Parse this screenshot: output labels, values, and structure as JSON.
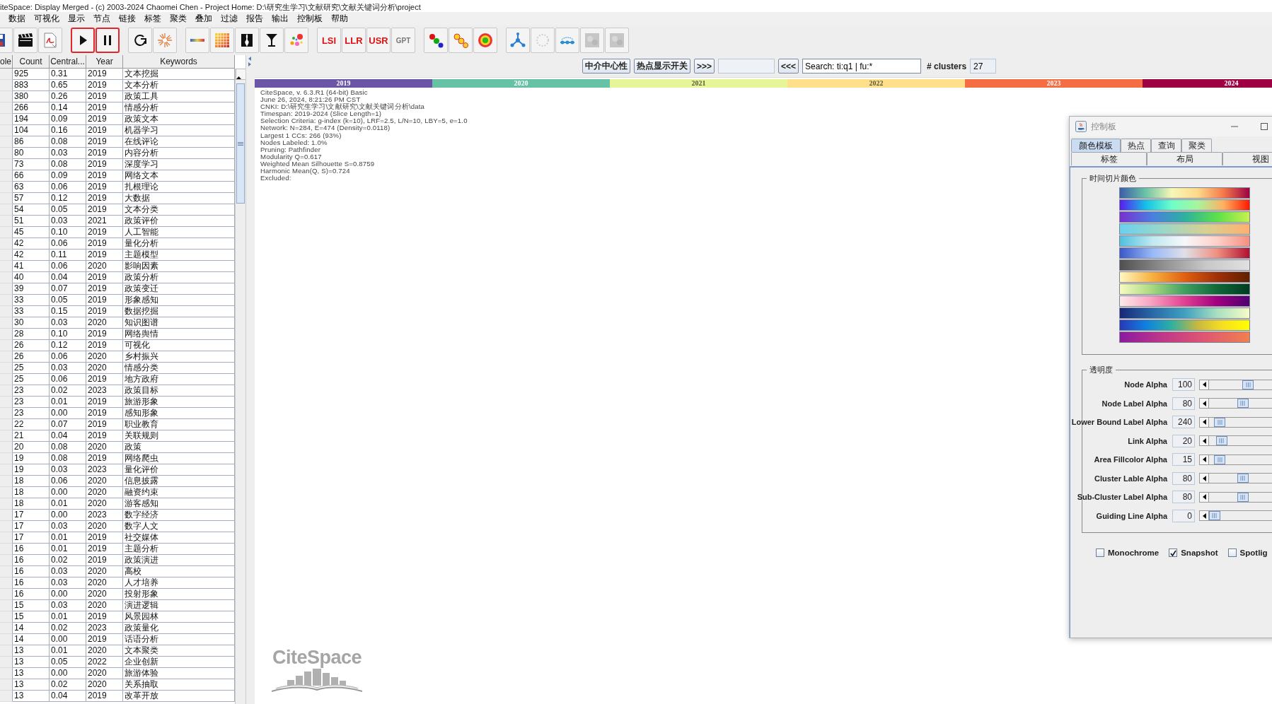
{
  "window": {
    "title": "iteSpace: Display Merged - (c) 2003-2024 Chaomei Chen - Project Home: D:\\研究生学习\\文献研究\\文献关键词分析\\project"
  },
  "menu": [
    "数据",
    "可视化",
    "显示",
    "节点",
    "链接",
    "标签",
    "聚类",
    "叠加",
    "过滤",
    "报告",
    "输出",
    "控制板",
    "帮助"
  ],
  "toolbar": [
    [
      {
        "kind": "save",
        "highlighted": false,
        "disabled": false
      },
      {
        "kind": "clapper",
        "highlighted": false,
        "disabled": false
      },
      {
        "kind": "pdf",
        "highlighted": false,
        "disabled": false
      }
    ],
    [
      {
        "kind": "play",
        "highlighted": true,
        "disabled": false
      },
      {
        "kind": "pause",
        "highlighted": true,
        "disabled": false
      }
    ],
    [
      {
        "kind": "refresh",
        "highlighted": false,
        "disabled": false
      },
      {
        "kind": "starburst",
        "highlighted": false,
        "disabled": false
      }
    ],
    [
      {
        "kind": "gradient-line",
        "highlighted": false,
        "disabled": false
      },
      {
        "kind": "color-grid",
        "highlighted": false,
        "disabled": false
      },
      {
        "kind": "silhouette",
        "highlighted": false,
        "disabled": false
      },
      {
        "kind": "funnel",
        "highlighted": false,
        "disabled": false
      },
      {
        "kind": "splash",
        "highlighted": false,
        "disabled": false
      }
    ],
    [
      {
        "kind": "text",
        "label": "LSI",
        "highlighted": false,
        "disabled": false
      },
      {
        "kind": "text",
        "label": "LLR",
        "highlighted": false,
        "disabled": false
      },
      {
        "kind": "text",
        "label": "USR",
        "highlighted": false,
        "disabled": false
      },
      {
        "kind": "text",
        "label": "GPT",
        "highlighted": false,
        "disabled": true
      }
    ],
    [
      {
        "kind": "dots-rgb",
        "highlighted": false,
        "disabled": false
      },
      {
        "kind": "dots-yellow",
        "highlighted": false,
        "disabled": false
      },
      {
        "kind": "ring",
        "highlighted": false,
        "disabled": false
      }
    ],
    [
      {
        "kind": "tree",
        "highlighted": false,
        "disabled": false
      },
      {
        "kind": "spinner",
        "highlighted": false,
        "disabled": true
      },
      {
        "kind": "link",
        "highlighted": false,
        "disabled": false
      },
      {
        "kind": "gray-square",
        "highlighted": false,
        "disabled": true
      },
      {
        "kind": "gray-square",
        "highlighted": false,
        "disabled": true
      }
    ]
  ],
  "table": {
    "columns": [
      "ole",
      "Count",
      "Central...",
      "Year",
      "Keywords"
    ],
    "rows": [
      [
        "",
        "925",
        "0.31",
        "2019",
        "文本挖掘"
      ],
      [
        "",
        "883",
        "0.65",
        "2019",
        "文本分析"
      ],
      [
        "",
        "380",
        "0.26",
        "2019",
        "政策工具"
      ],
      [
        "",
        "266",
        "0.14",
        "2019",
        "情感分析"
      ],
      [
        "",
        "194",
        "0.09",
        "2019",
        "政策文本"
      ],
      [
        "",
        "104",
        "0.16",
        "2019",
        "机器学习"
      ],
      [
        "",
        "86",
        "0.08",
        "2019",
        "在线评论"
      ],
      [
        "",
        "80",
        "0.03",
        "2019",
        "内容分析"
      ],
      [
        "",
        "73",
        "0.08",
        "2019",
        "深度学习"
      ],
      [
        "",
        "66",
        "0.09",
        "2019",
        "网络文本"
      ],
      [
        "",
        "63",
        "0.06",
        "2019",
        "扎根理论"
      ],
      [
        "",
        "57",
        "0.12",
        "2019",
        "大数据"
      ],
      [
        "",
        "54",
        "0.05",
        "2019",
        "文本分类"
      ],
      [
        "",
        "51",
        "0.03",
        "2021",
        "政策评价"
      ],
      [
        "",
        "45",
        "0.10",
        "2019",
        "人工智能"
      ],
      [
        "",
        "42",
        "0.06",
        "2019",
        "量化分析"
      ],
      [
        "",
        "42",
        "0.11",
        "2019",
        "主题模型"
      ],
      [
        "",
        "41",
        "0.06",
        "2020",
        "影响因素"
      ],
      [
        "",
        "40",
        "0.04",
        "2019",
        "政策分析"
      ],
      [
        "",
        "39",
        "0.07",
        "2019",
        "政策变迁"
      ],
      [
        "",
        "33",
        "0.05",
        "2019",
        "形象感知"
      ],
      [
        "",
        "33",
        "0.15",
        "2019",
        "数据挖掘"
      ],
      [
        "",
        "30",
        "0.03",
        "2020",
        "知识图谱"
      ],
      [
        "",
        "28",
        "0.10",
        "2019",
        "网络舆情"
      ],
      [
        "",
        "26",
        "0.12",
        "2019",
        "可视化"
      ],
      [
        "",
        "26",
        "0.06",
        "2020",
        "乡村振兴"
      ],
      [
        "",
        "25",
        "0.03",
        "2020",
        "情感分类"
      ],
      [
        "",
        "25",
        "0.06",
        "2019",
        "地方政府"
      ],
      [
        "",
        "23",
        "0.02",
        "2023",
        "政策目标"
      ],
      [
        "",
        "23",
        "0.01",
        "2019",
        "旅游形象"
      ],
      [
        "",
        "23",
        "0.00",
        "2019",
        "感知形象"
      ],
      [
        "",
        "22",
        "0.07",
        "2019",
        "职业教育"
      ],
      [
        "",
        "21",
        "0.04",
        "2019",
        "关联规则"
      ],
      [
        "",
        "20",
        "0.08",
        "2020",
        "政策"
      ],
      [
        "",
        "19",
        "0.08",
        "2019",
        "网络爬虫"
      ],
      [
        "",
        "19",
        "0.03",
        "2023",
        "量化评价"
      ],
      [
        "",
        "18",
        "0.06",
        "2020",
        "信息披露"
      ],
      [
        "",
        "18",
        "0.00",
        "2020",
        "融资约束"
      ],
      [
        "",
        "18",
        "0.01",
        "2020",
        "游客感知"
      ],
      [
        "",
        "17",
        "0.00",
        "2023",
        "数字经济"
      ],
      [
        "",
        "17",
        "0.03",
        "2020",
        "数字人文"
      ],
      [
        "",
        "17",
        "0.01",
        "2019",
        "社交媒体"
      ],
      [
        "",
        "16",
        "0.01",
        "2019",
        "主题分析"
      ],
      [
        "",
        "16",
        "0.02",
        "2019",
        "政策演进"
      ],
      [
        "",
        "16",
        "0.03",
        "2020",
        "高校"
      ],
      [
        "",
        "16",
        "0.03",
        "2020",
        "人才培养"
      ],
      [
        "",
        "16",
        "0.00",
        "2020",
        "投射形象"
      ],
      [
        "",
        "15",
        "0.03",
        "2020",
        "演进逻辑"
      ],
      [
        "",
        "15",
        "0.01",
        "2019",
        "风景园林"
      ],
      [
        "",
        "14",
        "0.02",
        "2023",
        "政策量化"
      ],
      [
        "",
        "14",
        "0.00",
        "2019",
        "话语分析"
      ],
      [
        "",
        "13",
        "0.01",
        "2020",
        "文本聚类"
      ],
      [
        "",
        "13",
        "0.05",
        "2022",
        "企业创新"
      ],
      [
        "",
        "13",
        "0.00",
        "2020",
        "旅游体验"
      ],
      [
        "",
        "13",
        "0.02",
        "2020",
        "关系抽取"
      ],
      [
        "",
        "13",
        "0.04",
        "2019",
        "改革开放"
      ]
    ]
  },
  "controls": [
    {
      "kind": "button",
      "label": "中介中心性"
    },
    {
      "kind": "button",
      "label": "热点显示开关"
    },
    {
      "kind": "button",
      "label": ">>>"
    },
    {
      "kind": "field"
    },
    {
      "kind": "button",
      "label": "<<<"
    },
    {
      "kind": "search",
      "value": "Search: ti:q1 | fu:*"
    },
    {
      "kind": "label",
      "label": "# clusters"
    },
    {
      "kind": "field",
      "value": "27"
    }
  ],
  "timeline": [
    {
      "label": "2019",
      "color": "#6a55a6"
    },
    {
      "label": "2020",
      "color": "#66c2a5"
    },
    {
      "label": "2021",
      "color": "#e6f598"
    },
    {
      "label": "2022",
      "color": "#fee08b"
    },
    {
      "label": "2023",
      "color": "#f46d43"
    },
    {
      "label": "2024",
      "color": "#9e0142"
    }
  ],
  "summary": [
    "CiteSpace, v. 6.3.R1 (64-bit) Basic",
    "June 26, 2024, 8:21:26 PM CST",
    "CNKI: D:\\研究生学习\\文献研究\\文献关键词分析\\data",
    "Timespan: 2019-2024 (Slice Length=1)",
    "Selection Criteria: g-index (k=10), LRF=2.5, L/N=10, LBY=5, e=1.0",
    "Network: N=284, E=474 (Density=0.0118)",
    "Largest 1 CCs: 266 (93%)",
    "Nodes Labeled: 1.0%",
    "Pruning: Pathfinder",
    "Modularity Q=0.617",
    "Weighted Mean Silhouette S=0.8759",
    "Harmonic Mean(Q, S)=0.724",
    "Excluded:"
  ],
  "logo": {
    "text": "CiteSpace"
  },
  "panel": {
    "title": "控制板",
    "tab_rows": [
      [
        {
          "label": "颜色模板",
          "selected": true
        },
        {
          "label": "热点",
          "selected": false
        },
        {
          "label": "查询",
          "selected": false
        },
        {
          "label": "聚类",
          "selected": false
        }
      ],
      [
        {
          "label": "标签",
          "selected": false
        },
        {
          "label": "布局",
          "selected": false
        },
        {
          "label": "视图",
          "selected": false
        }
      ]
    ],
    "color_group": "时间切片颜色",
    "alpha_group": "透明度",
    "sliders": [
      {
        "label": "Node Alpha",
        "value": "100",
        "level": 0.22
      },
      {
        "label": "Node Label Alpha",
        "value": "80",
        "level": 0.19
      },
      {
        "label": "Lower Bound Label Alpha",
        "value": "240",
        "level": 0.06
      },
      {
        "label": "Link Alpha",
        "value": "20",
        "level": 0.07
      },
      {
        "label": "Area Fillcolor Alpha",
        "value": "15",
        "level": 0.06
      },
      {
        "label": "Cluster Lable Alpha",
        "value": "80",
        "level": 0.19
      },
      {
        "label": "Sub-Cluster Label Alpha",
        "value": "80",
        "level": 0.19
      },
      {
        "label": "Guiding Line Alpha",
        "value": "0",
        "level": 0.03
      }
    ],
    "checkboxes": [
      {
        "label": "Monochrome",
        "checked": false
      },
      {
        "label": "Snapshot",
        "checked": true
      },
      {
        "label": "Spotlig",
        "checked": false
      }
    ]
  }
}
